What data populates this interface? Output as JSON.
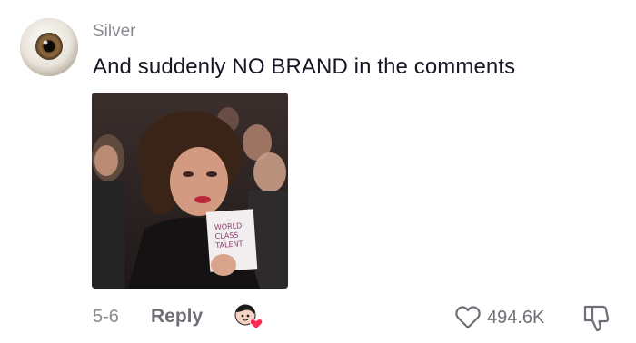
{
  "comment": {
    "author": "Silver",
    "text": "And suddenly NO BRAND in the comments",
    "date": "5-6",
    "reply_label": "Reply",
    "like_count": "494.6K",
    "gif_sign_text": "WORLD CLASS TALENT"
  },
  "icons": {
    "avatar": "eye-avatar",
    "like": "heart-outline-icon",
    "dislike": "thumbs-down-icon",
    "creator_liked": "creator-avatar-heart-icon"
  },
  "colors": {
    "text_primary": "#161823",
    "text_secondary": "#8a8b91",
    "heart_badge": "#fe2c55"
  }
}
